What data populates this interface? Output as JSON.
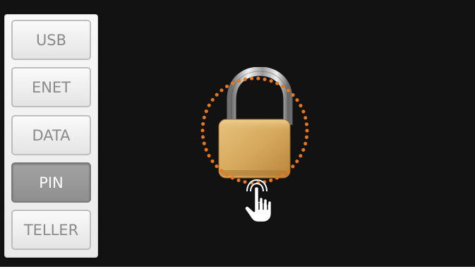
{
  "sidebar": {
    "items": [
      {
        "label": "USB",
        "active": false
      },
      {
        "label": "ENET",
        "active": false
      },
      {
        "label": "DATA",
        "active": false
      },
      {
        "label": "PIN",
        "active": true
      },
      {
        "label": "TELLER",
        "active": false
      }
    ]
  },
  "lock": {
    "icon": "padlock-icon",
    "highlight_color": "#e8761a",
    "pointer_icon": "hand-pointer-icon"
  },
  "colors": {
    "screen_background": "#121212",
    "active_tab": "#999999"
  }
}
